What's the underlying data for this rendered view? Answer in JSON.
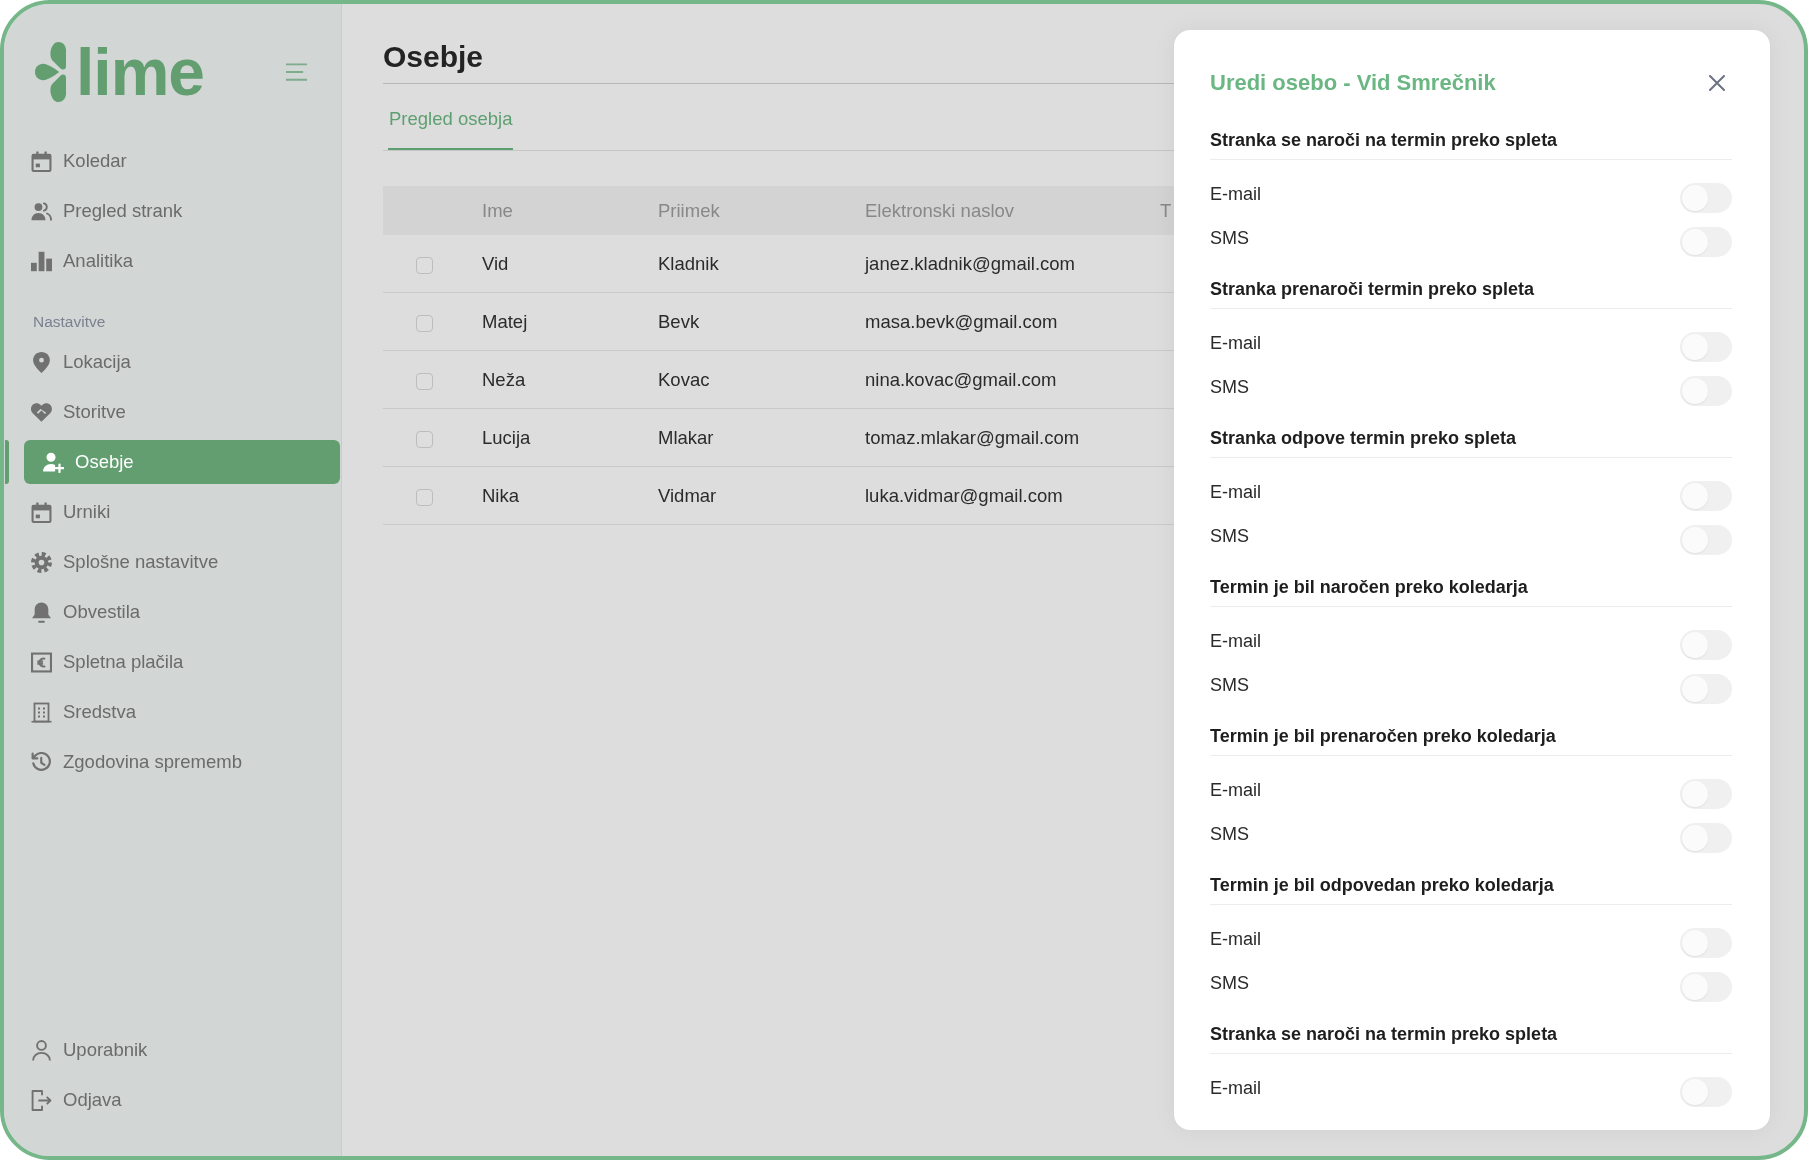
{
  "sidebar": {
    "logo": "lime",
    "main_nav": [
      {
        "label": "Koledar",
        "selected": false
      },
      {
        "label": "Pregled strank",
        "selected": false
      },
      {
        "label": "Analitika",
        "selected": false
      }
    ],
    "section_label": "Nastavitve",
    "settings_nav": [
      {
        "label": "Lokacija",
        "selected": false
      },
      {
        "label": "Storitve",
        "selected": false
      },
      {
        "label": "Osebje",
        "selected": true
      },
      {
        "label": "Urniki",
        "selected": false
      },
      {
        "label": "Splošne nastavitve",
        "selected": false
      },
      {
        "label": "Obvestila",
        "selected": false
      },
      {
        "label": "Spletna plačila",
        "selected": false
      },
      {
        "label": "Sredstva",
        "selected": false
      },
      {
        "label": "Zgodovina sprememb",
        "selected": false
      }
    ],
    "footer_nav": [
      {
        "label": "Uporabnik",
        "selected": false
      },
      {
        "label": "Odjava",
        "selected": false
      }
    ]
  },
  "page": {
    "title": "Osebje",
    "tabs": [
      {
        "label": "Pregled osebja",
        "selected": true
      }
    ]
  },
  "table": {
    "columns": [
      "Ime",
      "Priimek",
      "Elektronski naslov",
      "T"
    ],
    "rows": [
      {
        "checked": false,
        "cells": [
          "Vid",
          "Kladnik",
          "janez.kladnik@gmail.com"
        ]
      },
      {
        "checked": false,
        "cells": [
          "Matej",
          "Bevk",
          "masa.bevk@gmail.com"
        ]
      },
      {
        "checked": false,
        "cells": [
          "Neža",
          "Kovac",
          "nina.kovac@gmail.com"
        ]
      },
      {
        "checked": false,
        "cells": [
          "Lucija",
          "Mlakar",
          "tomaz.mlakar@gmail.com"
        ]
      },
      {
        "checked": false,
        "cells": [
          "Nika",
          "Vidmar",
          "luka.vidmar@gmail.com"
        ]
      }
    ]
  },
  "drawer": {
    "title": "Uredi osebo - Vid Smrečnik",
    "sections": [
      {
        "heading": "Stranka se naroči na termin preko spleta",
        "options": [
          {
            "label": "E-mail",
            "on": false
          },
          {
            "label": "SMS",
            "on": false
          }
        ]
      },
      {
        "heading": "Stranka prenaroči termin preko spleta",
        "options": [
          {
            "label": "E-mail",
            "on": false
          },
          {
            "label": "SMS",
            "on": false
          }
        ]
      },
      {
        "heading": "Stranka odpove termin preko spleta",
        "options": [
          {
            "label": "E-mail",
            "on": false
          },
          {
            "label": "SMS",
            "on": false
          }
        ]
      },
      {
        "heading": "Termin je bil naročen preko koledarja",
        "options": [
          {
            "label": "E-mail",
            "on": false
          },
          {
            "label": "SMS",
            "on": false
          }
        ]
      },
      {
        "heading": "Termin je bil prenaročen preko koledarja",
        "options": [
          {
            "label": "E-mail",
            "on": false
          },
          {
            "label": "SMS",
            "on": false
          }
        ]
      },
      {
        "heading": "Termin je bil odpovedan preko koledarja",
        "options": [
          {
            "label": "E-mail",
            "on": false
          },
          {
            "label": "SMS",
            "on": false
          }
        ]
      },
      {
        "heading": "Stranka se naroči na termin preko spleta",
        "options": [
          {
            "label": "E-mail",
            "on": false
          }
        ]
      }
    ]
  }
}
